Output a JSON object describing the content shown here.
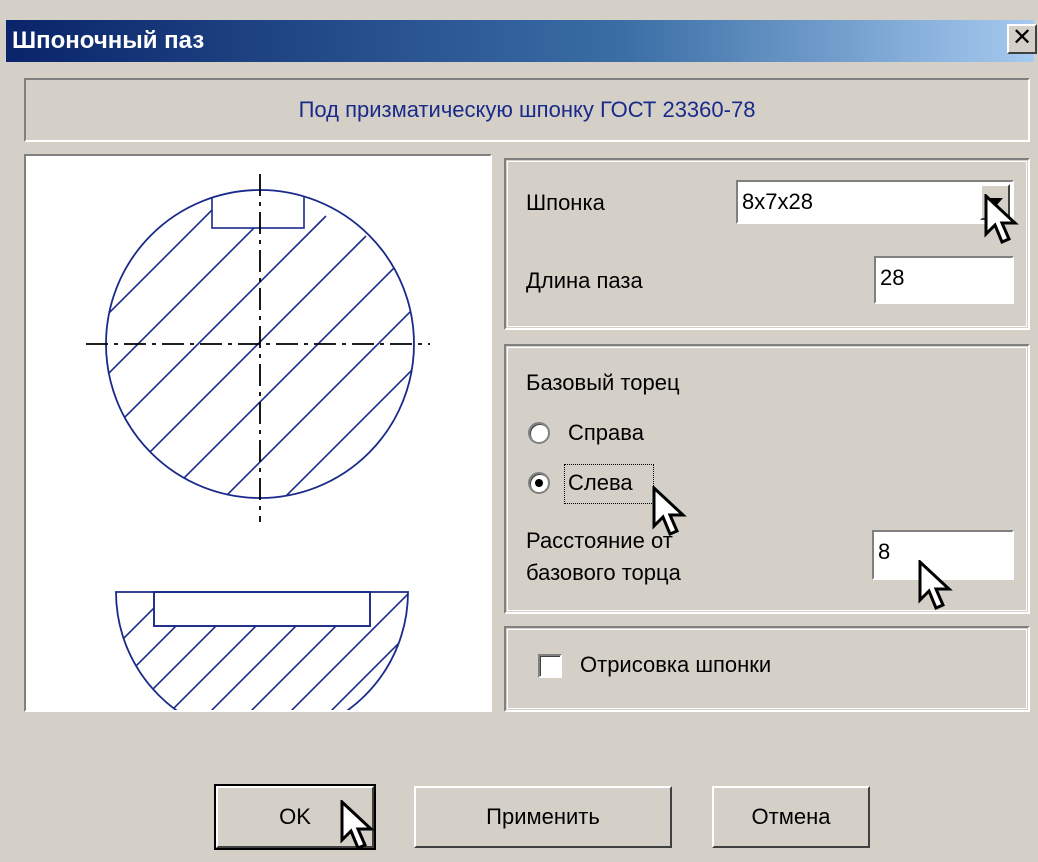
{
  "window": {
    "title": "Шпоночный паз",
    "close_glyph": "✕"
  },
  "header": {
    "text": "Под призматическую шпонку ГОСТ 23360-78"
  },
  "key_group": {
    "key_label": "Шпонка",
    "key_value": "8x7x28",
    "slot_length_label": "Длина паза",
    "slot_length_value": "28"
  },
  "base_group": {
    "title": "Базовый торец",
    "option_right": "Справа",
    "option_left": "Слева",
    "selected": "left",
    "distance_label_line1": "Расстояние от",
    "distance_label_line2": "базового торца",
    "distance_value": "8"
  },
  "draw_group": {
    "checkbox_label": "Отрисовка шпонки",
    "checked": false
  },
  "buttons": {
    "ok": "OK",
    "apply": "Применить",
    "cancel": "Отмена"
  },
  "colors": {
    "drawing_line": "#1a2a8a",
    "header_text": "#1a2a8a",
    "titlebar_start": "#0a246a"
  }
}
